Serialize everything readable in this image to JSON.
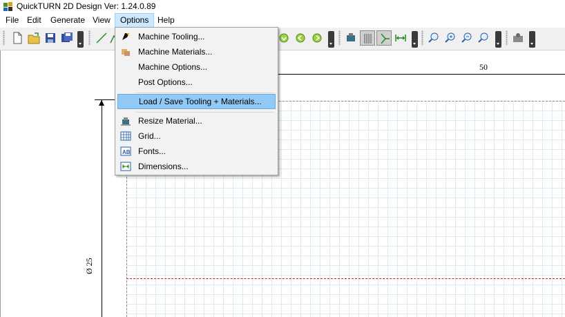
{
  "window": {
    "title": "QuickTURN 2D Design Ver: 1.24.0.89",
    "icon": "app-icon"
  },
  "menubar": {
    "items": [
      {
        "label": "File"
      },
      {
        "label": "Edit"
      },
      {
        "label": "Generate"
      },
      {
        "label": "View"
      },
      {
        "label": "Options",
        "active": true
      },
      {
        "label": "Help"
      }
    ]
  },
  "options_menu": {
    "items": [
      {
        "label": "Machine Tooling...",
        "icon": "tool-holder-icon"
      },
      {
        "label": "Machine Materials...",
        "icon": "materials-icon"
      },
      {
        "label": "Machine Options...",
        "icon": ""
      },
      {
        "label": "Post Options...",
        "icon": ""
      },
      {
        "label": "Load / Save Tooling + Materials...",
        "icon": "",
        "highlighted": true
      },
      {
        "label": "Resize Material...",
        "icon": "resize-material-icon"
      },
      {
        "label": "Grid...",
        "icon": "grid-icon"
      },
      {
        "label": "Fonts...",
        "icon": "fonts-icon"
      },
      {
        "label": "Dimensions...",
        "icon": "dimensions-icon"
      }
    ]
  },
  "drawing": {
    "top_dimension": "50",
    "left_dimension": "Ø 25"
  },
  "colors": {
    "menu_highlight": "#91c9f7",
    "menubar_active": "#cce8ff",
    "grid_line": "#dcecf2",
    "centerline": "#c42020"
  }
}
